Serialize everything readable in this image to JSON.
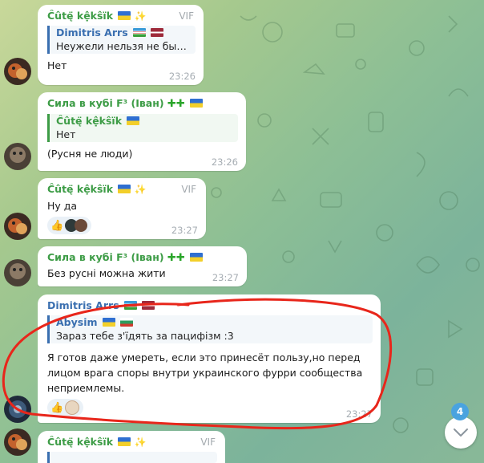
{
  "colors": {
    "sender_green": "#3d9c46",
    "sender_blue": "#3a6fb0",
    "badge": "#4aa3df",
    "annotation_red": "#e8261b"
  },
  "messages": [
    {
      "sender": "Ĉûtę̈ kệkŝïk",
      "via": "VIF",
      "reply_name": "Dimitris Arrs",
      "reply_text": "Неужели нельзя не быть в...",
      "text": "Нет",
      "time": "23:26"
    },
    {
      "sender": "Сила в кубі F³ (Іван)",
      "reply_name": "Ĉûtę̈ kệkŝïk",
      "reply_text": "Нет",
      "text": "(Русня не люди)",
      "time": "23:26"
    },
    {
      "sender": "Ĉûtę̈ kệkŝïk",
      "via": "VIF",
      "text": "Ну да",
      "time": "23:27"
    },
    {
      "sender": "Сила в кубі F³ (Іван)",
      "text": "Без русні можна жити",
      "time": "23:27"
    },
    {
      "sender": "Dimitris Arrs",
      "reply_name": "Abysim",
      "reply_text": "Зараз тебе з'їдять за пацифізм :3",
      "text": "Я готов даже умереть, если это принесёт пользу,но перед лицом врага споры внутри украинского фурри сообщества неприемлемы.",
      "time": "23:27"
    },
    {
      "sender": "Ĉûtę̈ kệkŝïk",
      "via": "VIF"
    }
  ],
  "scroll": {
    "unread_count": "4",
    "icon": "chevron-down-icon"
  }
}
